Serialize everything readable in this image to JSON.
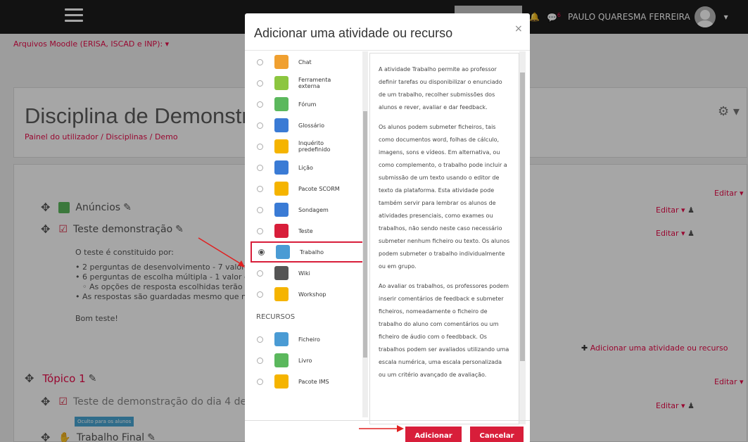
{
  "navbar": {
    "user_name": "PAULO QUARESMA FERREIRA",
    "notif_count": "6"
  },
  "top_link": "Arquivos Moodle (ERISA, ISCAD e INP): ▾",
  "course": {
    "title": "Disciplina de Demonstr",
    "breadcrumb": "Painel do utilizador  /  Disciplinas  /  Demo"
  },
  "sections": {
    "s0": {
      "anuncios": "Anúncios",
      "teste": "Teste demonstração",
      "edit": "Editar ▾",
      "desc_title": "O teste é constituido por:",
      "bullets": [
        "2 perguntas de desenvolvimento  - 7 valor",
        "6 perguntas de escolha múltipla - 1 valor c",
        "As opções de resposta escolhidas terão",
        "As respostas são guardadas mesmo que n"
      ],
      "bom": "Bom teste!",
      "add": "Adicionar uma atividade ou recurso"
    },
    "s1": {
      "title": "Tópico 1",
      "item1": "Teste de demonstração do dia 4 de",
      "hidden": "Oculto para os alunos",
      "item2": "Trabalho Final"
    }
  },
  "modal": {
    "title": "Adicionar uma atividade ou recurso",
    "activities": [
      {
        "label": "Chat",
        "icon": "chat-icon",
        "color": "#f0a030"
      },
      {
        "label": "Ferramenta externa",
        "icon": "puzzle-icon",
        "color": "#8cc63f"
      },
      {
        "label": "Fórum",
        "icon": "forum-icon",
        "color": "#5bb85d"
      },
      {
        "label": "Glossário",
        "icon": "glossary-icon",
        "color": "#3a7bd5"
      },
      {
        "label": "Inquérito predefinido",
        "icon": "survey-icon",
        "color": "#f5b400"
      },
      {
        "label": "Lição",
        "icon": "lesson-icon",
        "color": "#3a7bd5"
      },
      {
        "label": "Pacote SCORM",
        "icon": "scorm-icon",
        "color": "#f5b400"
      },
      {
        "label": "Sondagem",
        "icon": "question-icon",
        "color": "#3a7bd5"
      },
      {
        "label": "Teste",
        "icon": "quiz-icon",
        "color": "#d81e3a"
      },
      {
        "label": "Trabalho",
        "icon": "assignment-icon",
        "color": "#4a9bd4"
      },
      {
        "label": "Wiki",
        "icon": "wiki-icon",
        "color": "#555555"
      },
      {
        "label": "Workshop",
        "icon": "workshop-icon",
        "color": "#f5b400"
      }
    ],
    "resources_header": "RECURSOS",
    "resources": [
      {
        "label": "Ficheiro",
        "icon": "file-icon",
        "color": "#4a9bd4"
      },
      {
        "label": "Livro",
        "icon": "book-icon",
        "color": "#5bb85d"
      },
      {
        "label": "Pacote IMS",
        "icon": "ims-icon",
        "color": "#f5b400"
      }
    ],
    "selected": "Trabalho",
    "description": [
      "A atividade Trabalho permite ao professor definir tarefas ou disponibilizar o enunciado de um trabalho, recolher submissões dos alunos e rever, avaliar e dar feedback.",
      "Os alunos podem submeter ficheiros, tais como documentos word, folhas de cálculo, imagens, sons e vídeos. Em alternativa, ou como complemento, o trabalho pode incluir a submissão de um texto usando o editor de texto da plataforma. Esta atividade pode também servir para lembrar os alunos de atividades presenciais, como exames ou trabalhos, não sendo neste caso necessário submeter nenhum ficheiro ou texto. Os alunos podem submeter o trabalho individualmente ou em grupo.",
      "Ao avaliar os trabalhos, os professores podem inserir comentários de feedback e submeter ficheiros, nomeadamente o ficheiro de trabalho do aluno com comentários ou um ficheiro de áudio com o feedbback. Os trabalhos podem ser avaliados utilizando uma escala numérica, uma escala personalizada ou um critério avançado de avaliação."
    ],
    "add_button": "Adicionar",
    "cancel_button": "Cancelar"
  },
  "colors": {
    "accent": "#d81e3a",
    "link": "#ea0c4a"
  }
}
